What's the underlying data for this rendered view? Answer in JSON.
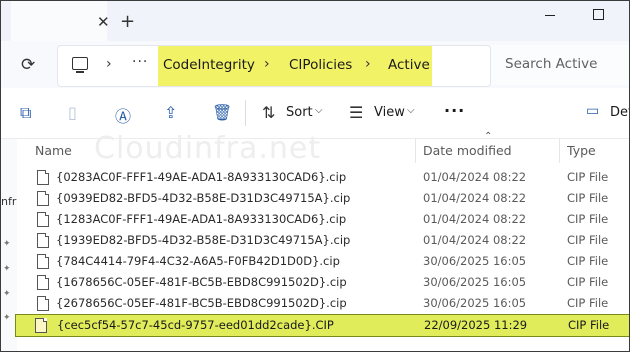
{
  "window": {
    "close_glyph": "✕",
    "new_tab_glyph": "+"
  },
  "address": {
    "overflow": "···",
    "crumbs": [
      "CodeIntegrity",
      "CIPolicies",
      "Active"
    ],
    "search_placeholder": "Search Active"
  },
  "toolbar": {
    "sort_label": "Sort",
    "view_label": "View",
    "more_label": "···",
    "details_label": "Det"
  },
  "nav": {
    "partial_label": "nfr"
  },
  "watermark": "Cloudinfra.net",
  "columns": {
    "name": "Name",
    "date": "Date modified",
    "type": "Type"
  },
  "files": [
    {
      "name": "{0283AC0F-FFF1-49AE-ADA1-8A933130CAD6}.cip",
      "date": "01/04/2024 08:22",
      "type": "CIP File"
    },
    {
      "name": "{0939ED82-BFD5-4D32-B58E-D31D3C49715A}.cip",
      "date": "01/04/2024 08:22",
      "type": "CIP File"
    },
    {
      "name": "{1283AC0F-FFF1-49AE-ADA1-8A933130CAD6}.cip",
      "date": "01/04/2024 08:22",
      "type": "CIP File"
    },
    {
      "name": "{1939ED82-BFD5-4D32-B58E-D31D3C49715A}.cip",
      "date": "01/04/2024 08:22",
      "type": "CIP File"
    },
    {
      "name": "{784C4414-79F4-4C32-A6A5-F0FB42D1D0D}.cip",
      "date": "30/06/2025 16:05",
      "type": "CIP File"
    },
    {
      "name": "{1678656C-05EF-481F-BC5B-EBD8C991502D}.cip",
      "date": "30/06/2025 16:05",
      "type": "CIP File"
    },
    {
      "name": "{2678656C-05EF-481F-BC5B-EBD8C991502D}.cip",
      "date": "30/06/2025 16:05",
      "type": "CIP File"
    },
    {
      "name": "{cec5cf54-57c7-45cd-9757-eed01dd2cade}.CIP",
      "date": "22/09/2025 11:29",
      "type": "CIP File"
    }
  ],
  "highlight_color": "#e1ec5a",
  "address_highlight_color": "#f2f266"
}
